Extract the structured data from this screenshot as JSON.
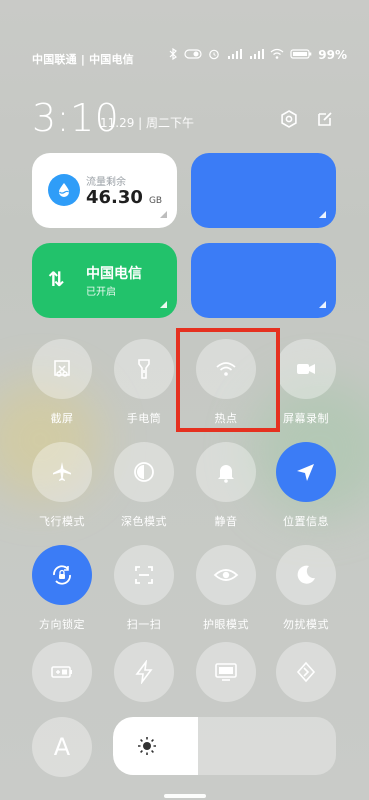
{
  "status_bar": {
    "carriers": "中国联通 | 中国电信",
    "battery": "99%"
  },
  "header": {
    "time": "3:10",
    "date": "11.29 | 周二下午"
  },
  "cards": {
    "data": {
      "label": "流量剩余",
      "value": "46.30",
      "unit": "GB"
    },
    "mobile_network": {
      "title": "中国电信",
      "subtitle": "已开启"
    }
  },
  "tiles": [
    {
      "label": "截屏",
      "icon": "screenshot-icon",
      "active": false
    },
    {
      "label": "手电筒",
      "icon": "flashlight-icon",
      "active": false
    },
    {
      "label": "热点",
      "icon": "hotspot-icon",
      "active": false
    },
    {
      "label": "屏幕录制",
      "icon": "screen-record-icon",
      "active": false
    },
    {
      "label": "飞行模式",
      "icon": "airplane-icon",
      "active": false
    },
    {
      "label": "深色模式",
      "icon": "dark-mode-icon",
      "active": false
    },
    {
      "label": "静音",
      "icon": "bell-icon",
      "active": false
    },
    {
      "label": "位置信息",
      "icon": "location-arrow-icon",
      "active": true
    },
    {
      "label": "方向锁定",
      "icon": "rotation-lock-icon",
      "active": true
    },
    {
      "label": "扫一扫",
      "icon": "scan-icon",
      "active": false
    },
    {
      "label": "护眼模式",
      "icon": "eye-icon",
      "active": false
    },
    {
      "label": "勿扰模式",
      "icon": "moon-icon",
      "active": false
    }
  ],
  "bottom": {
    "auto_brightness_label": "A",
    "brightness_level": 0.38
  },
  "colors": {
    "accent_blue": "#3b7cf6",
    "green": "#22c26b",
    "highlight_red": "#e5301f"
  }
}
